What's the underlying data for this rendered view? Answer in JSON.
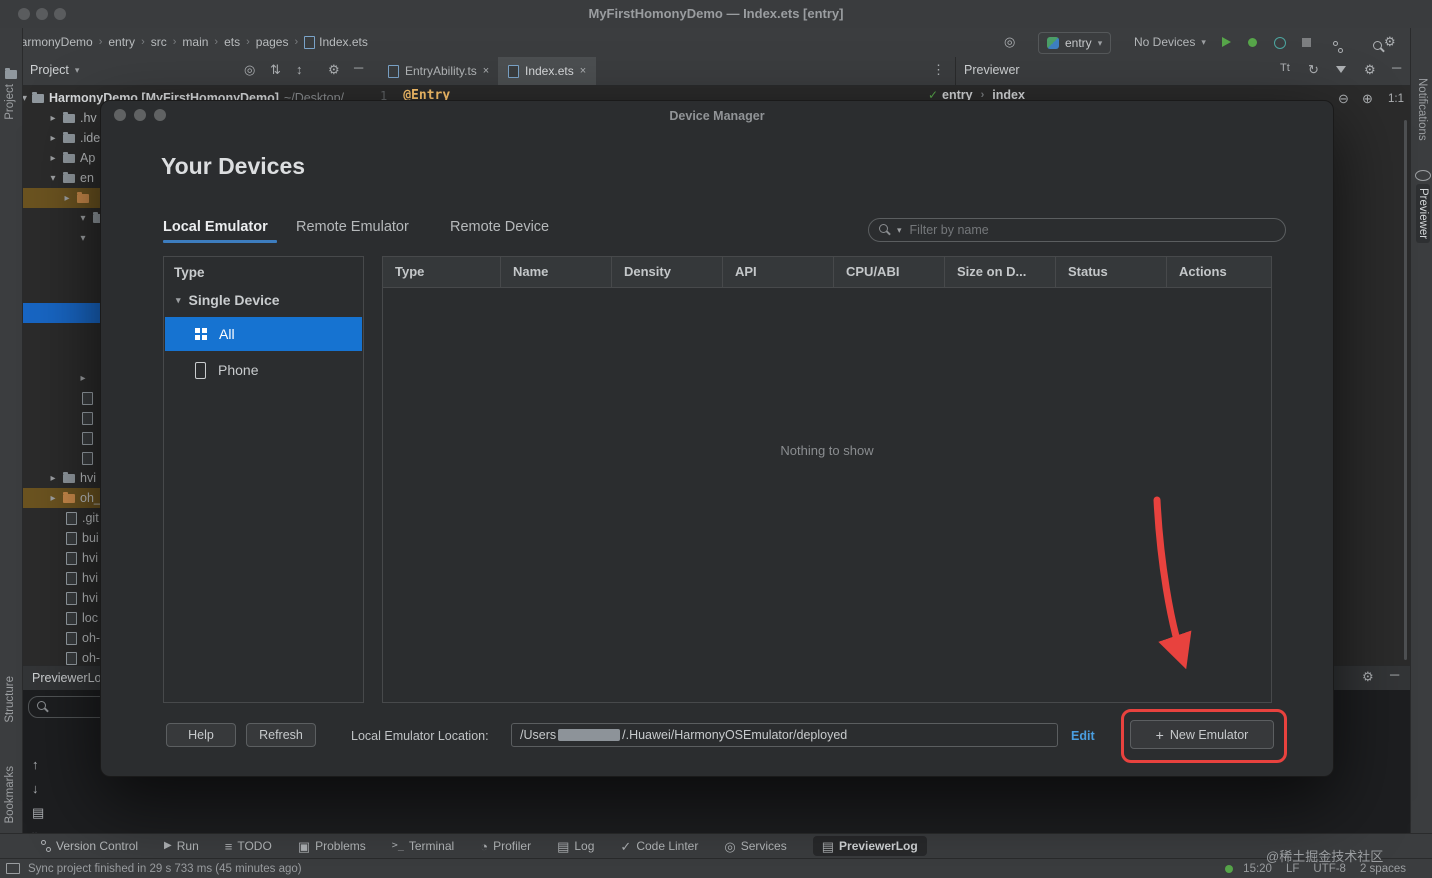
{
  "window": {
    "title": "MyFirstHomonyDemo — Index.ets [entry]"
  },
  "toolbar": {
    "breadcrumbs": [
      "HarmonyDemo",
      "entry",
      "src",
      "main",
      "ets",
      "pages",
      "Index.ets"
    ],
    "run_config": "entry",
    "device_selector": "No Devices"
  },
  "strips": {
    "left_top": "Project",
    "left_middle": "Structure",
    "left_bottom": "Bookmarks",
    "right_top": "Notifications",
    "right_bottom": "Previewer"
  },
  "panels": {
    "project": {
      "title": "Project",
      "root_name": "HarmonyDemo [MyFirstHomonyDemo]",
      "root_path": "~/Desktop/",
      "rows": [
        {
          "label": ".hv"
        },
        {
          "label": ".ide"
        },
        {
          "label": "Ap"
        },
        {
          "label": "en"
        },
        {
          "label": "hvi"
        },
        {
          "label": "oh_"
        },
        {
          "label": ".git"
        },
        {
          "label": "bui"
        },
        {
          "label": "hvi"
        },
        {
          "label": "hvi"
        },
        {
          "label": "hvi"
        },
        {
          "label": "loc"
        },
        {
          "label": "oh-"
        },
        {
          "label": "oh-"
        }
      ]
    },
    "editor": {
      "tabs": [
        {
          "label": "EntryAbility.ts"
        },
        {
          "label": "Index.ets"
        }
      ],
      "gutter_line": "1",
      "code_line": "@Entry"
    },
    "previewer": {
      "title": "Previewer",
      "crumbs": [
        "entry",
        "index"
      ],
      "zoom_ratio": "1:1"
    },
    "previewer_log": {
      "title": "PreviewerLog"
    }
  },
  "dialog": {
    "title": "Device Manager",
    "heading": "Your Devices",
    "tabs": [
      {
        "label": "Local Emulator"
      },
      {
        "label": "Remote Emulator"
      },
      {
        "label": "Remote Device"
      }
    ],
    "filter_placeholder": "Filter by name",
    "type_panel": {
      "header": "Type",
      "group": "Single Device",
      "items": [
        {
          "label": "All"
        },
        {
          "label": "Phone"
        }
      ]
    },
    "table": {
      "columns": [
        "Type",
        "Name",
        "Density",
        "API",
        "CPU/ABI",
        "Size on D...",
        "Status",
        "Actions"
      ],
      "empty_text": "Nothing to show"
    },
    "footer": {
      "help": "Help",
      "refresh": "Refresh",
      "location_label": "Local Emulator Location:",
      "location_prefix": "/Users",
      "location_suffix": "/.Huawei/HarmonyOSEmulator/deployed",
      "edit": "Edit",
      "new_emulator_label": "New Emulator"
    },
    "accent_red": "#e8423e",
    "selection_blue": "#1673d1"
  },
  "bottom_bar": {
    "items": [
      {
        "label": "Version Control"
      },
      {
        "label": "Run"
      },
      {
        "label": "TODO"
      },
      {
        "label": "Problems"
      },
      {
        "label": "Terminal"
      },
      {
        "label": "Profiler"
      },
      {
        "label": "Log"
      },
      {
        "label": "Code Linter"
      },
      {
        "label": "Services"
      },
      {
        "label": "PreviewerLog"
      }
    ]
  },
  "status_bar": {
    "message": "Sync project finished in 29 s 733 ms (45 minutes ago)",
    "time": "15:20",
    "line_sep": "LF",
    "encoding": "UTF-8",
    "indent": "2 spaces",
    "watermark": "@稀土掘金技术社区"
  }
}
